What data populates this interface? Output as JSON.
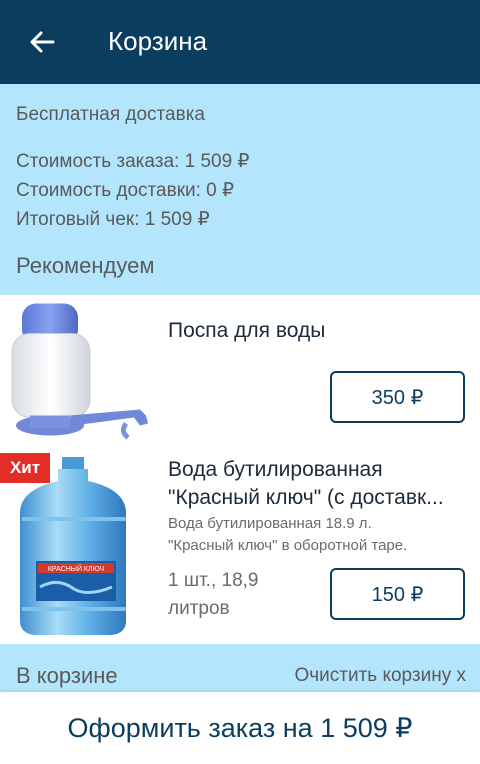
{
  "header": {
    "title": "Корзина",
    "back_icon": "arrow-left-icon"
  },
  "summary": {
    "delivery_note": "Бесплатная доставка",
    "order_cost": "Стоимость заказа: 1 509 ₽",
    "delivery_cost": "Стоимость доставки: 0 ₽",
    "total": "Итоговый чек: 1 509 ₽"
  },
  "recommend": {
    "title": "Рекомендуем",
    "items": [
      {
        "name": "Поспа для воды",
        "price": "350 ₽",
        "image": "water-pump-image"
      },
      {
        "name": "Вода бутилированная \"Красный ключ\" (с доставк...",
        "description_line1": "Вода бутилированная 18.9 л.",
        "description_line2": "\"Красный ключ\" в оборотной таре.",
        "qty_line1": "1 шт., 18,9",
        "qty_line2": "литров",
        "price": "150 ₽",
        "badge": "Хит",
        "image": "water-bottle-image",
        "bottle_label": "КРАСНЫЙ КЛЮЧ"
      }
    ]
  },
  "cart": {
    "title": "В корзине",
    "clear_label": "Очистить корзину х"
  },
  "checkout": {
    "label": "Оформить заказ на 1 509 ₽"
  },
  "colors": {
    "primary": "#0b3d5f",
    "background": "#b3e5fc",
    "badge": "#e52d27"
  }
}
